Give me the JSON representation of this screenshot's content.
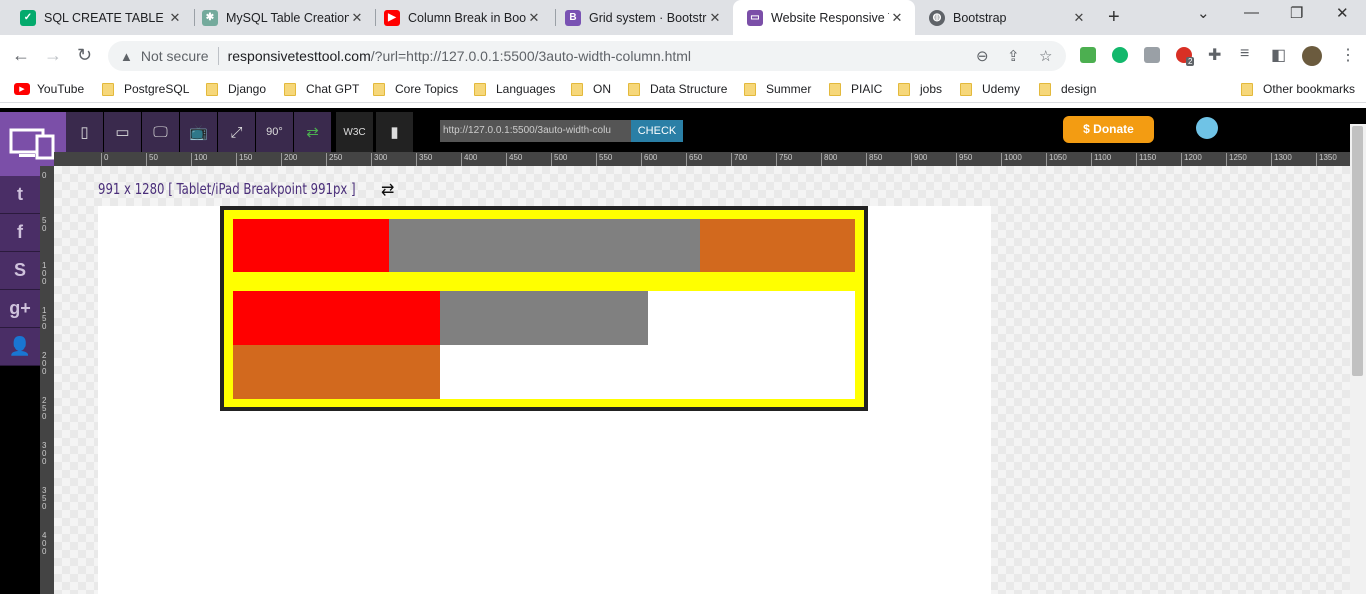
{
  "tabs": [
    {
      "title": "SQL CREATE TABLE Sta",
      "icon": "shield-icon",
      "color": "#04aa6d"
    },
    {
      "title": "MySQL Table Creation",
      "icon": "openai-icon",
      "color": "#74aa9c"
    },
    {
      "title": "Column Break in Boot",
      "icon": "youtube-icon",
      "color": "#ff0000"
    },
    {
      "title": "Grid system · Bootstrap",
      "icon": "bootstrap-icon",
      "color": "#7952b3"
    },
    {
      "title": "Website Responsive Te",
      "icon": "responsive-icon",
      "color": "#7b4fa8"
    },
    {
      "title": "Bootstrap",
      "icon": "globe-icon",
      "color": "#5f6368"
    }
  ],
  "address": {
    "security": "Not secure",
    "domain": "responsivetesttool.com",
    "path": "/?url=http://127.0.0.1:5500/3auto-width-column.html"
  },
  "ext_badge": "2",
  "bookmarks": [
    "YouTube",
    "PostgreSQL",
    "Django",
    "Chat GPT",
    "Core Topics",
    "Languages",
    "ON",
    "Data Structure",
    "Summer",
    "PIAIC",
    "jobs",
    "Udemy",
    "design"
  ],
  "other_bookmarks": "Other bookmarks",
  "tool": {
    "url_value": "http://127.0.0.1:5500/3auto-width-colu",
    "check_label": "CHECK",
    "donate_label": "$ Donate",
    "w3c_label": "W3C",
    "rotate_label": "90°",
    "breakpoint_label": "991 x 1280 [ Tablet/iPad Breakpoint 991px ]"
  },
  "ruler_top": [
    "0",
    "50",
    "100",
    "150",
    "200",
    "250",
    "300",
    "350",
    "400",
    "450",
    "500",
    "550",
    "600",
    "650",
    "700",
    "750",
    "800",
    "850",
    "900",
    "950",
    "1000",
    "1050",
    "1100",
    "1150",
    "1200",
    "1250",
    "1300",
    "1350"
  ],
  "ruler_left": [
    "0",
    "50",
    "100",
    "150",
    "200",
    "250",
    "300",
    "350",
    "400"
  ],
  "preview": {
    "frame_color": "#ffff00",
    "row1": [
      {
        "color": "#ff0000",
        "share": 0.25
      },
      {
        "color": "#808080",
        "share": 0.5
      },
      {
        "color": "#d2691e",
        "share": 0.25
      }
    ],
    "row2": [
      {
        "color": "#ff0000"
      },
      {
        "color": "#808080"
      },
      {
        "color": "#d2691e"
      }
    ]
  }
}
